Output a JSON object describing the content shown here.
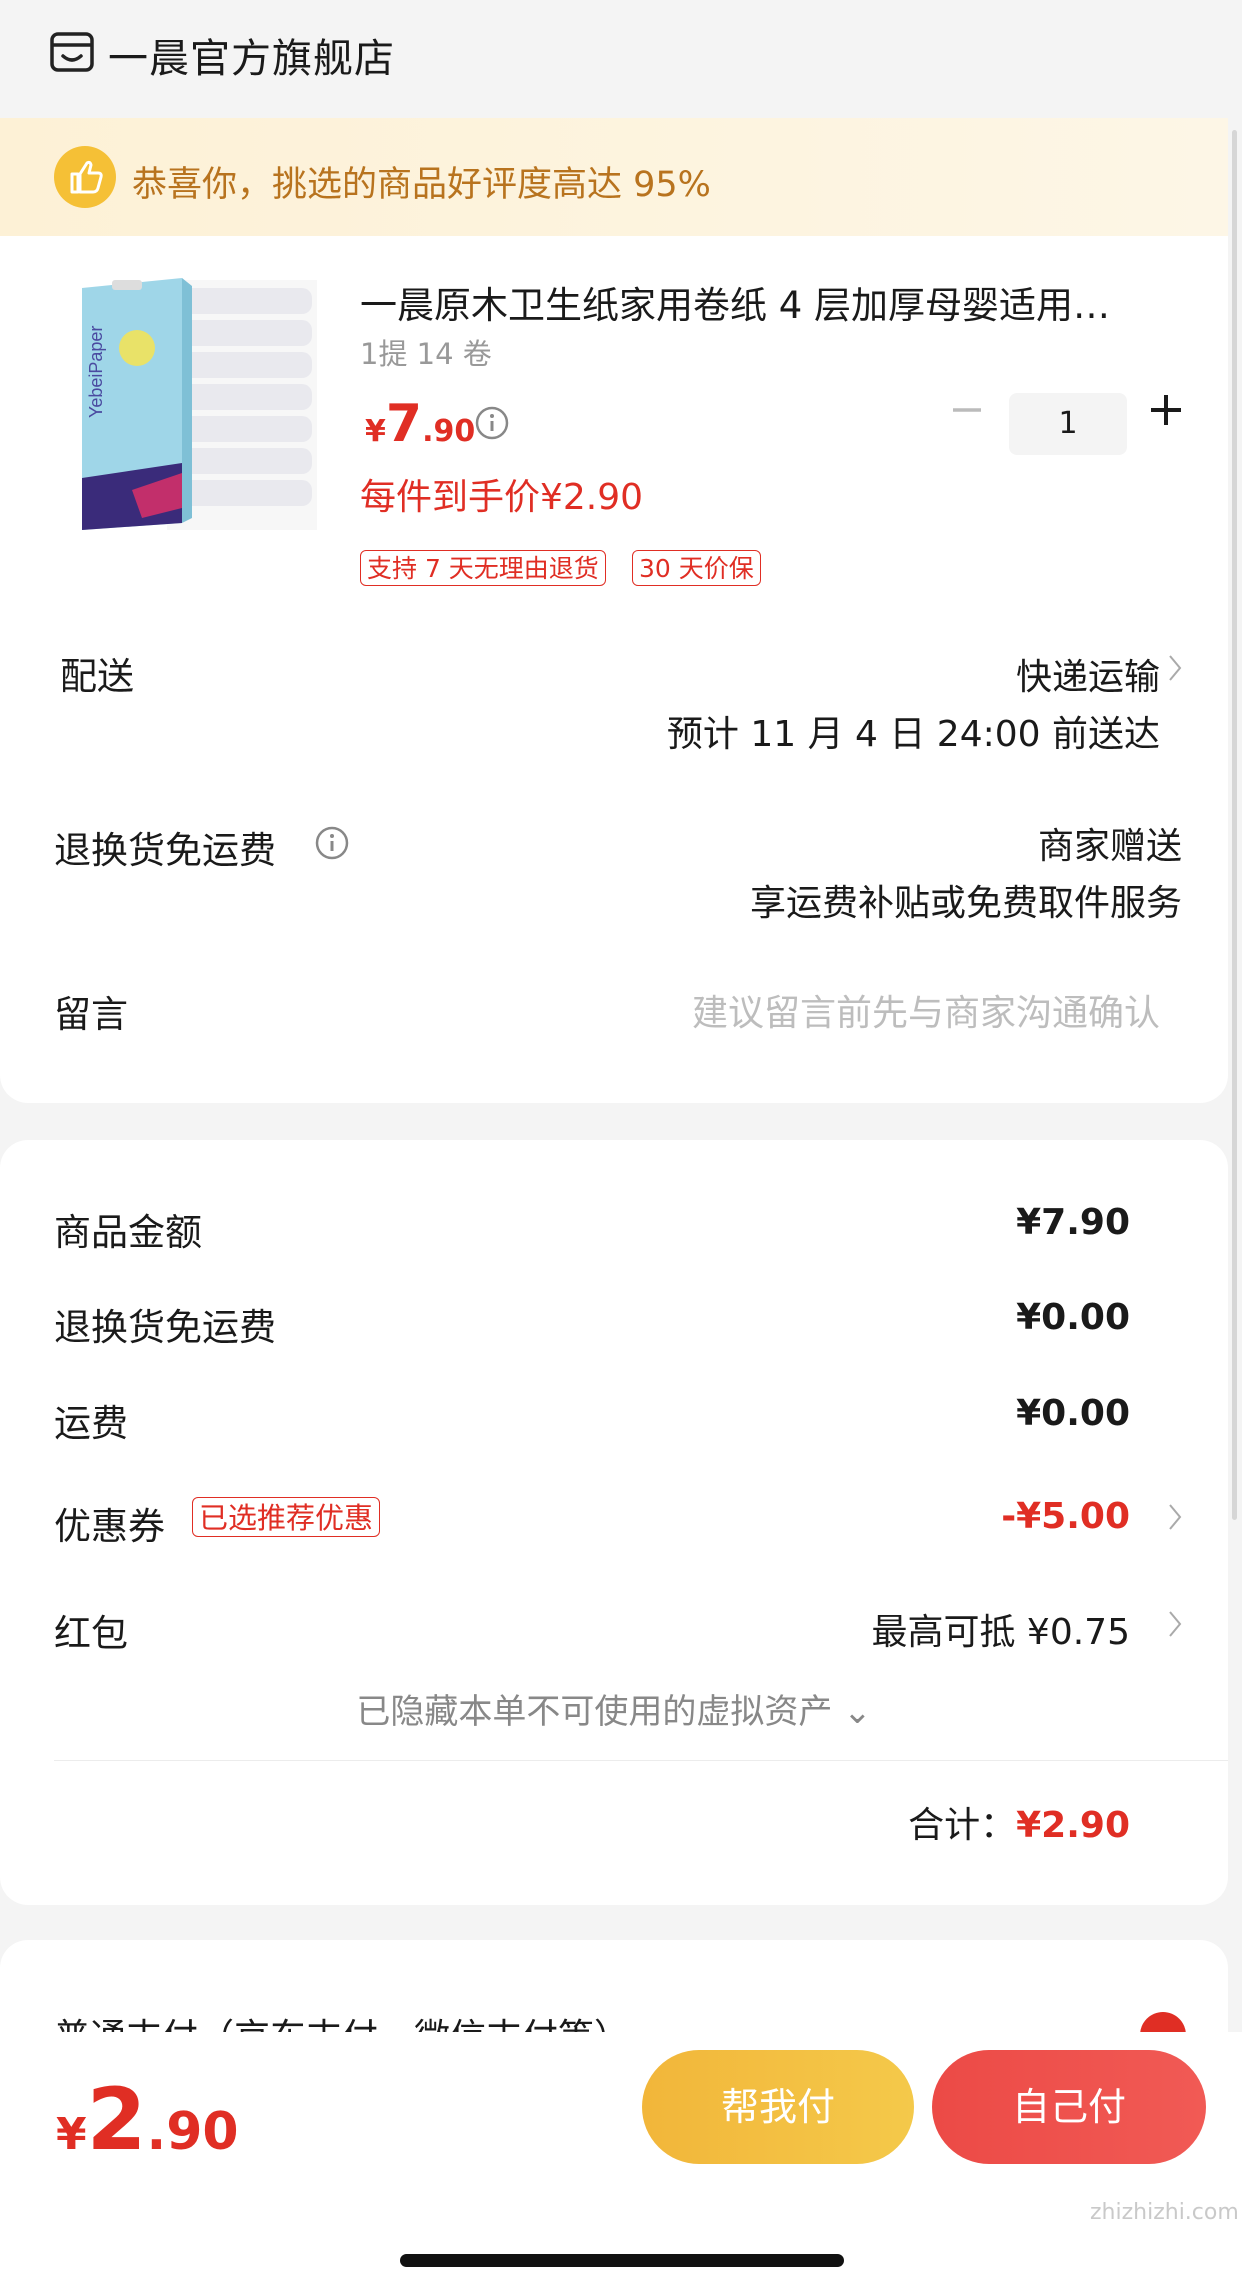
{
  "header": {
    "store_name": "一晨官方旗舰店",
    "store_icon": "store-icon"
  },
  "banner": {
    "text": "恭喜你，挑选的商品好评度高达 95%",
    "icon": "thumbs-up-icon"
  },
  "product": {
    "title": "一晨原木卫生纸家用卷纸 4 层加厚母婴适用…",
    "spec": "1提 14 卷",
    "price_symbol": "¥",
    "price_int": "7",
    "price_dec": ".90",
    "final_price": "每件到手价¥2.90",
    "tags": [
      "支持 7 天无理由退货",
      "30 天价保"
    ],
    "quantity": "1"
  },
  "delivery": {
    "label": "配送",
    "method": "快递运输",
    "eta": "预计 11 月 4 日 24:00 前送达"
  },
  "return_shipping": {
    "label": "退换货免运费",
    "value_line1": "商家赠送",
    "value_line2": "享运费补贴或免费取件服务"
  },
  "message": {
    "label": "留言",
    "placeholder": "建议留言前先与商家沟通确认"
  },
  "summary": {
    "goods_label": "商品金额",
    "goods_value": "¥7.90",
    "return_label": "退换货免运费",
    "return_value": "¥0.00",
    "shipping_label": "运费",
    "shipping_value": "¥0.00",
    "coupon_label": "优惠券",
    "coupon_tag": "已选推荐优惠",
    "coupon_value": "-¥5.00",
    "redpacket_label": "红包",
    "redpacket_value": "最高可抵 ¥0.75",
    "hidden_assets": "已隐藏本单不可使用的虚拟资产 ⌄",
    "total_label": "合计：",
    "total_value": "¥2.90"
  },
  "payment": {
    "text": "普通支付（京东支付，微信支付等）"
  },
  "bottom": {
    "price_symbol": "¥",
    "price_int": "2",
    "price_dec": ".90",
    "help_pay_label": "帮我付",
    "self_pay_label": "自己付"
  },
  "watermark": "zhizhizhi.com",
  "colors": {
    "accent": "#e02e24",
    "banner_text": "#b8731e",
    "help_btn": "#f2b63a",
    "self_btn": "#ec4a46"
  }
}
